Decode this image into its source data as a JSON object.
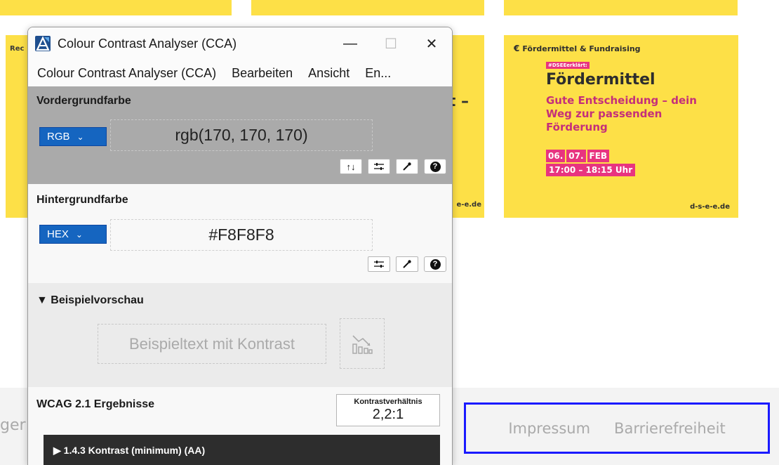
{
  "background_page": {
    "left_card_fragment": "Rec",
    "mid_card_dash": "t –",
    "mid_card_url": "e-e.de",
    "event_card": {
      "category": "Fördermittel & Fundraising",
      "tag": "#DSEEerklärt:",
      "headline": "Fördermittel",
      "description": "Gute Entscheidung – dein Weg zur passenden Förderung",
      "date_parts": [
        "06.",
        "07.",
        "FEB"
      ],
      "time": "17:00 – 18:15 Uhr",
      "url": "d-s-e-e.de"
    },
    "footer_fragment": "ger",
    "footer_links": [
      "Impressum",
      "Barrierefreiheit"
    ],
    "colors": {
      "card_yellow": "#fde047",
      "accent_pink": "#e8347f",
      "highlight_border": "#1a1aff"
    }
  },
  "cca": {
    "title": "Colour Contrast Analyser (CCA)",
    "window_controls": {
      "minimize": "—",
      "maximize": "☐",
      "close": "✕"
    },
    "menu": [
      "Colour Contrast Analyser (CCA)",
      "Bearbeiten",
      "Ansicht",
      "En..."
    ],
    "foreground": {
      "label": "Vordergrundfarbe",
      "format": "RGB",
      "value": "rgb(170, 170, 170)",
      "color": "#aaaaaa"
    },
    "background": {
      "label": "Hintergrundfarbe",
      "format": "HEX",
      "value": "#F8F8F8",
      "color": "#f8f8f8"
    },
    "preview": {
      "label": "▼ Beispielvorschau",
      "sample_text": "Beispieltext mit Kontrast"
    },
    "results": {
      "title": "WCAG 2.1 Ergebnisse",
      "ratio_label": "Kontrastverhältnis",
      "ratio_value": "2,2:1",
      "criterion": "▶  1.4.3 Kontrast (minimum) (AA)"
    },
    "icons": [
      "swap-icon",
      "sliders-icon",
      "eyedropper-icon",
      "help-icon",
      "chart-icon"
    ]
  }
}
